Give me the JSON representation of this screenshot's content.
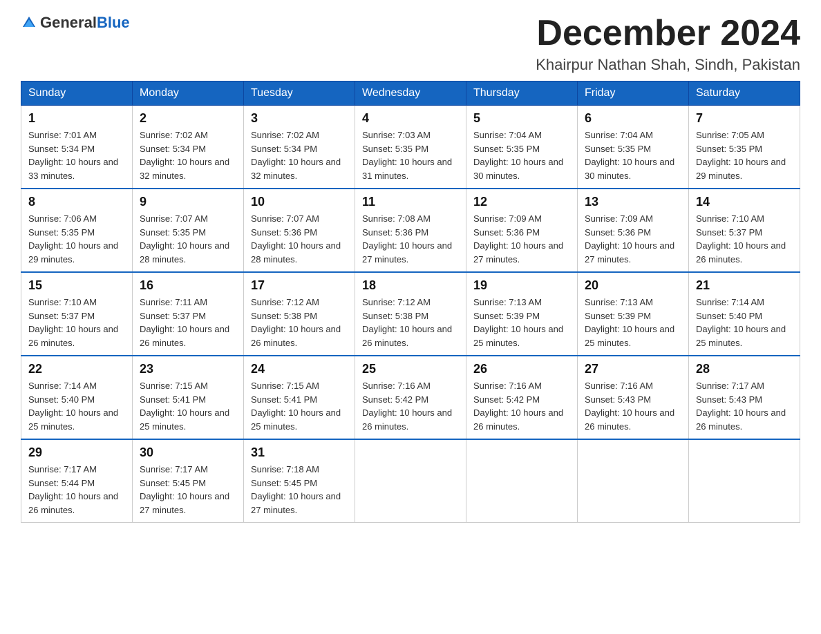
{
  "header": {
    "logo_general": "General",
    "logo_blue": "Blue",
    "month_title": "December 2024",
    "location": "Khairpur Nathan Shah, Sindh, Pakistan"
  },
  "weekdays": [
    "Sunday",
    "Monday",
    "Tuesday",
    "Wednesday",
    "Thursday",
    "Friday",
    "Saturday"
  ],
  "weeks": [
    [
      {
        "day": "1",
        "sunrise": "7:01 AM",
        "sunset": "5:34 PM",
        "daylight": "10 hours and 33 minutes."
      },
      {
        "day": "2",
        "sunrise": "7:02 AM",
        "sunset": "5:34 PM",
        "daylight": "10 hours and 32 minutes."
      },
      {
        "day": "3",
        "sunrise": "7:02 AM",
        "sunset": "5:34 PM",
        "daylight": "10 hours and 32 minutes."
      },
      {
        "day": "4",
        "sunrise": "7:03 AM",
        "sunset": "5:35 PM",
        "daylight": "10 hours and 31 minutes."
      },
      {
        "day": "5",
        "sunrise": "7:04 AM",
        "sunset": "5:35 PM",
        "daylight": "10 hours and 30 minutes."
      },
      {
        "day": "6",
        "sunrise": "7:04 AM",
        "sunset": "5:35 PM",
        "daylight": "10 hours and 30 minutes."
      },
      {
        "day": "7",
        "sunrise": "7:05 AM",
        "sunset": "5:35 PM",
        "daylight": "10 hours and 29 minutes."
      }
    ],
    [
      {
        "day": "8",
        "sunrise": "7:06 AM",
        "sunset": "5:35 PM",
        "daylight": "10 hours and 29 minutes."
      },
      {
        "day": "9",
        "sunrise": "7:07 AM",
        "sunset": "5:35 PM",
        "daylight": "10 hours and 28 minutes."
      },
      {
        "day": "10",
        "sunrise": "7:07 AM",
        "sunset": "5:36 PM",
        "daylight": "10 hours and 28 minutes."
      },
      {
        "day": "11",
        "sunrise": "7:08 AM",
        "sunset": "5:36 PM",
        "daylight": "10 hours and 27 minutes."
      },
      {
        "day": "12",
        "sunrise": "7:09 AM",
        "sunset": "5:36 PM",
        "daylight": "10 hours and 27 minutes."
      },
      {
        "day": "13",
        "sunrise": "7:09 AM",
        "sunset": "5:36 PM",
        "daylight": "10 hours and 27 minutes."
      },
      {
        "day": "14",
        "sunrise": "7:10 AM",
        "sunset": "5:37 PM",
        "daylight": "10 hours and 26 minutes."
      }
    ],
    [
      {
        "day": "15",
        "sunrise": "7:10 AM",
        "sunset": "5:37 PM",
        "daylight": "10 hours and 26 minutes."
      },
      {
        "day": "16",
        "sunrise": "7:11 AM",
        "sunset": "5:37 PM",
        "daylight": "10 hours and 26 minutes."
      },
      {
        "day": "17",
        "sunrise": "7:12 AM",
        "sunset": "5:38 PM",
        "daylight": "10 hours and 26 minutes."
      },
      {
        "day": "18",
        "sunrise": "7:12 AM",
        "sunset": "5:38 PM",
        "daylight": "10 hours and 26 minutes."
      },
      {
        "day": "19",
        "sunrise": "7:13 AM",
        "sunset": "5:39 PM",
        "daylight": "10 hours and 25 minutes."
      },
      {
        "day": "20",
        "sunrise": "7:13 AM",
        "sunset": "5:39 PM",
        "daylight": "10 hours and 25 minutes."
      },
      {
        "day": "21",
        "sunrise": "7:14 AM",
        "sunset": "5:40 PM",
        "daylight": "10 hours and 25 minutes."
      }
    ],
    [
      {
        "day": "22",
        "sunrise": "7:14 AM",
        "sunset": "5:40 PM",
        "daylight": "10 hours and 25 minutes."
      },
      {
        "day": "23",
        "sunrise": "7:15 AM",
        "sunset": "5:41 PM",
        "daylight": "10 hours and 25 minutes."
      },
      {
        "day": "24",
        "sunrise": "7:15 AM",
        "sunset": "5:41 PM",
        "daylight": "10 hours and 25 minutes."
      },
      {
        "day": "25",
        "sunrise": "7:16 AM",
        "sunset": "5:42 PM",
        "daylight": "10 hours and 26 minutes."
      },
      {
        "day": "26",
        "sunrise": "7:16 AM",
        "sunset": "5:42 PM",
        "daylight": "10 hours and 26 minutes."
      },
      {
        "day": "27",
        "sunrise": "7:16 AM",
        "sunset": "5:43 PM",
        "daylight": "10 hours and 26 minutes."
      },
      {
        "day": "28",
        "sunrise": "7:17 AM",
        "sunset": "5:43 PM",
        "daylight": "10 hours and 26 minutes."
      }
    ],
    [
      {
        "day": "29",
        "sunrise": "7:17 AM",
        "sunset": "5:44 PM",
        "daylight": "10 hours and 26 minutes."
      },
      {
        "day": "30",
        "sunrise": "7:17 AM",
        "sunset": "5:45 PM",
        "daylight": "10 hours and 27 minutes."
      },
      {
        "day": "31",
        "sunrise": "7:18 AM",
        "sunset": "5:45 PM",
        "daylight": "10 hours and 27 minutes."
      },
      null,
      null,
      null,
      null
    ]
  ]
}
